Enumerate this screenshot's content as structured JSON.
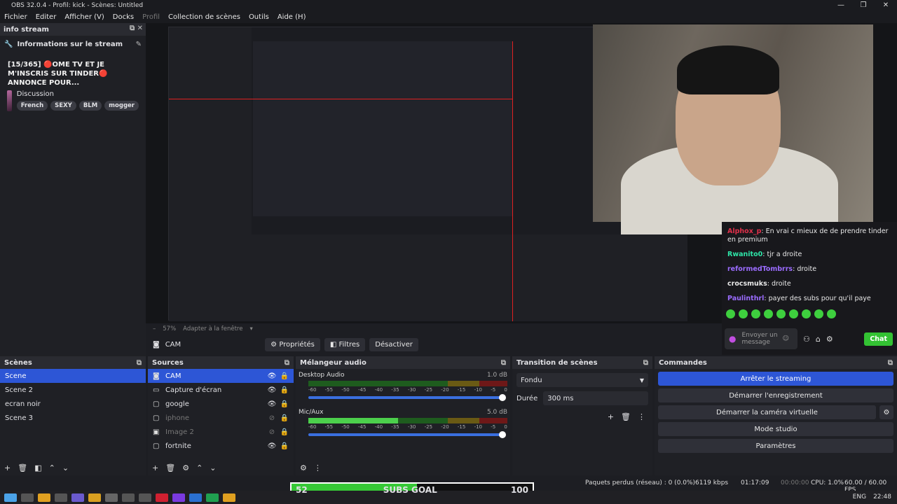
{
  "window": {
    "title": "OBS 32.0.4 - Profil: kick - Scènes: Untitled",
    "controls": [
      "—",
      "❐",
      "✕"
    ]
  },
  "menu": [
    "Fichier",
    "Editer",
    "Afficher (V)",
    "Docks",
    "Profil",
    "Collection de scènes",
    "Outils",
    "Aide (H)"
  ],
  "info_dock": {
    "header": "info stream",
    "section_title": "Informations sur le stream",
    "stream_title": "[15/365] 🔴OME TV ET JE M'INSCRIS SUR TINDER🔴 ANNONCE POUR...",
    "category": "Discussion",
    "tags": [
      "French",
      "SEXY",
      "BLM",
      "mogger"
    ]
  },
  "chat": {
    "messages": [
      {
        "user": "Alphox_p",
        "user_color": "#e0304a",
        "text": "En vrai c mieux de de prendre tinder en premium"
      },
      {
        "user": "Rwanito0",
        "user_color": "#2ee5a8",
        "text": "tjr a droite"
      },
      {
        "user": "reformedTombrrs",
        "user_color": "#9b6cff",
        "text": "droite"
      },
      {
        "user": "crocsmuks",
        "user_color": "#e8e8e8",
        "text": "droite"
      },
      {
        "user": "Paulinthrl",
        "user_color": "#9b6cff",
        "text": "payer des subs pour qu'il paye"
      }
    ],
    "send_placeholder": "Envoyer un message",
    "chat_button": "Chat"
  },
  "preview_controls": {
    "zoom": "57%",
    "fit": "Adapter à la fenêtre",
    "selected_source": "CAM",
    "buttons": [
      "Propriétés",
      "Filtres",
      "Désactiver"
    ]
  },
  "scenes": {
    "header": "Scènes",
    "items": [
      "Scene",
      "Scene 2",
      "ecran noir",
      "Scene 3"
    ],
    "selected": 0
  },
  "sources": {
    "header": "Sources",
    "items": [
      {
        "name": "CAM",
        "icon": "camera-icon",
        "visible": true,
        "selected": true
      },
      {
        "name": "Capture d'écran",
        "icon": "monitor-icon",
        "visible": true,
        "selected": false
      },
      {
        "name": "google",
        "icon": "window-icon",
        "visible": true,
        "selected": false
      },
      {
        "name": "iphone",
        "icon": "window-icon",
        "visible": false,
        "selected": false
      },
      {
        "name": "Image 2",
        "icon": "image-icon",
        "visible": false,
        "selected": false
      },
      {
        "name": "fortnite",
        "icon": "window-icon",
        "visible": true,
        "selected": false
      }
    ]
  },
  "mixer": {
    "header": "Mélangeur audio",
    "channels": [
      {
        "name": "Desktop Audio",
        "db": "1.0 dB",
        "level": 0.0
      },
      {
        "name": "Mic/Aux",
        "db": "5.0 dB",
        "level": 0.45
      }
    ],
    "ticks": [
      "-60",
      "-55",
      "-50",
      "-45",
      "-40",
      "-35",
      "-30",
      "-25",
      "-20",
      "-15",
      "-10",
      "-5",
      "0"
    ]
  },
  "transitions": {
    "header": "Transition de scènes",
    "selected": "Fondu",
    "duration_label": "Durée",
    "duration": "300 ms"
  },
  "commands": {
    "header": "Commandes",
    "buttons": [
      "Arrêter le streaming",
      "Démarrer l'enregistrement",
      "Démarrer la caméra virtuelle",
      "Mode studio",
      "Paramètres"
    ]
  },
  "status": {
    "dropped": "Paquets perdus (réseau) : 0 (0.0%)",
    "bitrate": "6119 kbps",
    "stream_time": "01:17:09",
    "rec_time": "00:00:00",
    "cpu": "CPU: 1.0%",
    "fps": "60.00 / 60.00 FPS"
  },
  "sub_goal": {
    "current": "52",
    "label": "SUBS GOAL",
    "target": "100",
    "fraction": 0.52
  },
  "taskbar": {
    "lang": "ENG",
    "time": "22:48"
  },
  "colors": {
    "accent": "#2d56d6",
    "chat_green": "#33c233"
  }
}
